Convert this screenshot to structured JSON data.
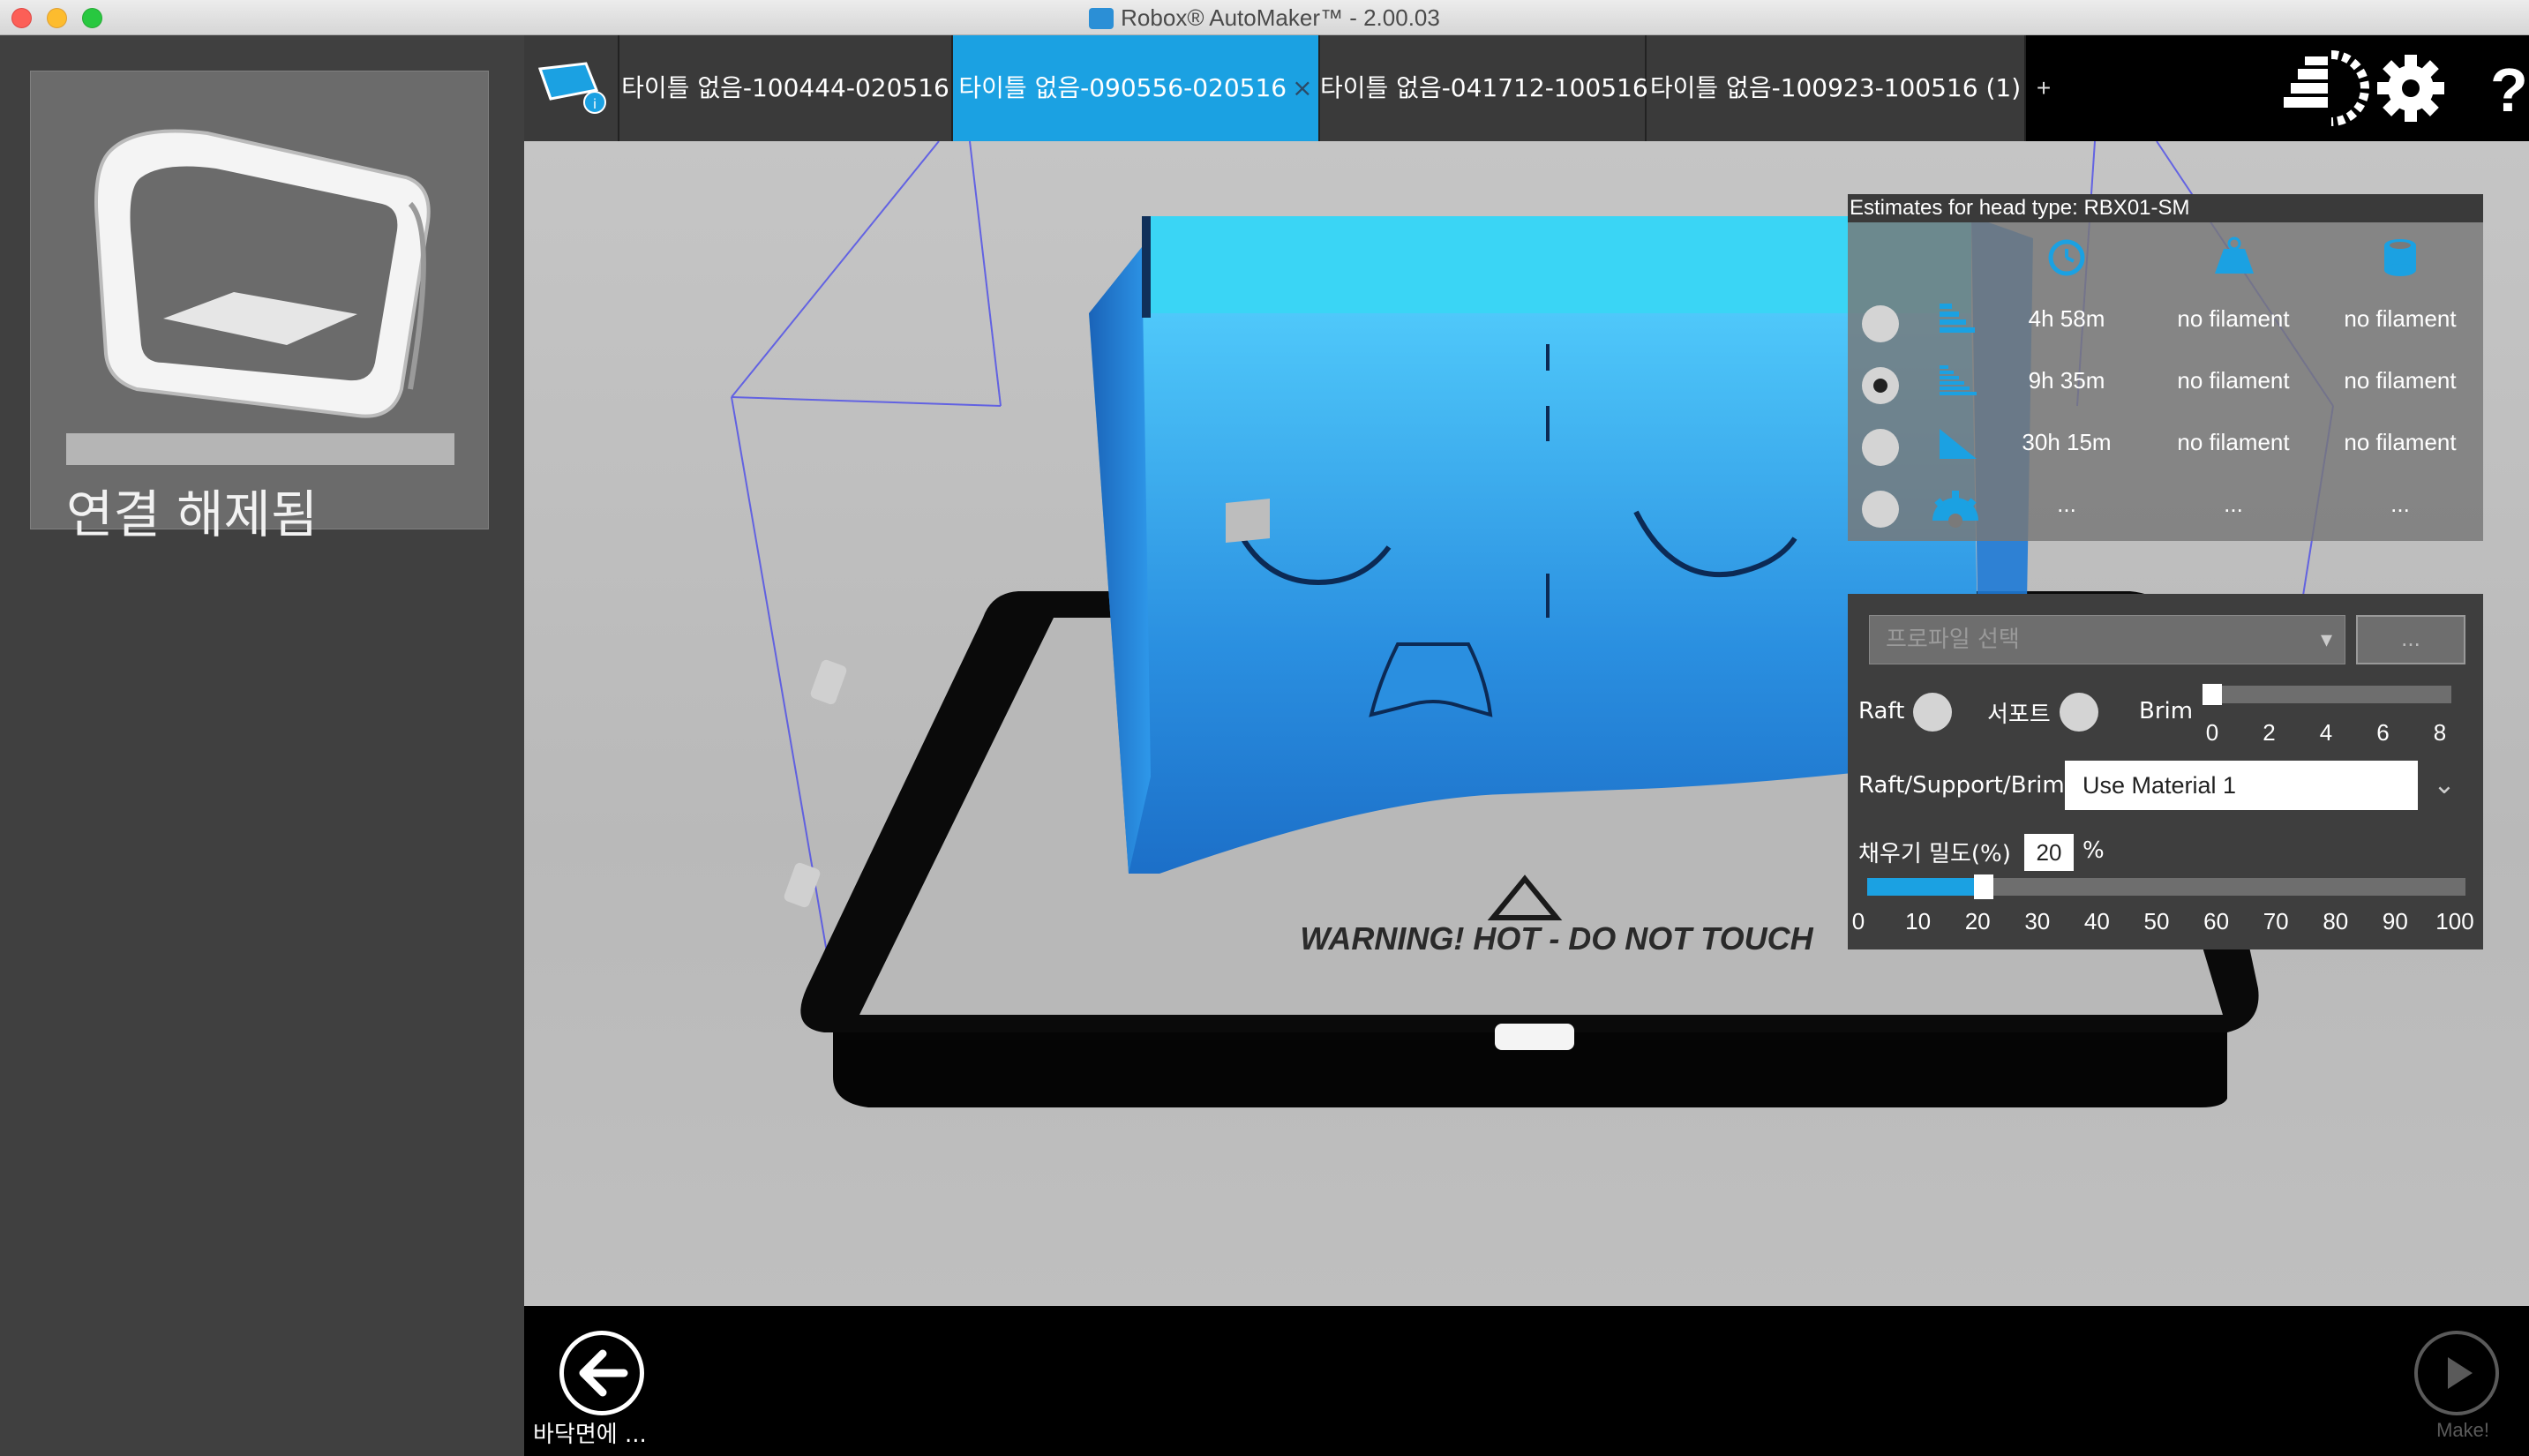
{
  "window": {
    "title": "Robox® AutoMaker™ - 2.00.03"
  },
  "sidebar": {
    "printer_status": "연결 해제됨"
  },
  "tabs": [
    {
      "label": "타이틀 없음-100444-020516",
      "active": false
    },
    {
      "label": "타이틀 없음-090556-020516",
      "active": true,
      "close": "×"
    },
    {
      "label": "타이틀 없음-041712-100516",
      "active": false
    },
    {
      "label": "타이틀 없음-100923-100516 (1)",
      "active": false
    }
  ],
  "tab_add": "+",
  "top_icons": [
    "layout-icon",
    "gear-icon",
    "help-icon"
  ],
  "help_glyph": "?",
  "viewport": {
    "bed_warning": "WARNING! HOT - DO NOT TOUCH"
  },
  "estimates": {
    "header": "Estimates for head type: RBX01-SM",
    "columns": [
      "time-icon",
      "weight-icon",
      "cost-icon"
    ],
    "rows": [
      {
        "selected": false,
        "time": "4h 58m",
        "weight": "no filament",
        "cost": "no filament"
      },
      {
        "selected": true,
        "time": "9h 35m",
        "weight": "no filament",
        "cost": "no filament"
      },
      {
        "selected": false,
        "time": "30h 15m",
        "weight": "no filament",
        "cost": "no filament"
      },
      {
        "selected": false,
        "time": "...",
        "weight": "...",
        "cost": "..."
      }
    ]
  },
  "settings": {
    "profile_placeholder": "프로파일 선택",
    "profile_more": "...",
    "raft_label": "Raft",
    "support_label": "서포트",
    "brim_label": "Brim",
    "brim_ticks": [
      "0",
      "2",
      "4",
      "6",
      "8"
    ],
    "brim_value": 0,
    "material_label": "Raft/Support/Brim",
    "material_value": "Use Material 1",
    "fill_label": "채우기 밀도(%)",
    "fill_value": "20",
    "fill_unit": "%",
    "fill_fraction": 0.2,
    "fill_ticks": [
      "0",
      "10",
      "20",
      "30",
      "40",
      "50",
      "60",
      "70",
      "80",
      "90",
      "100"
    ]
  },
  "bottom": {
    "back_label": "바닥면에 ...",
    "make_label": "Make!"
  },
  "colors": {
    "accent": "#1ba1e2",
    "model": "#2a8fe0"
  }
}
